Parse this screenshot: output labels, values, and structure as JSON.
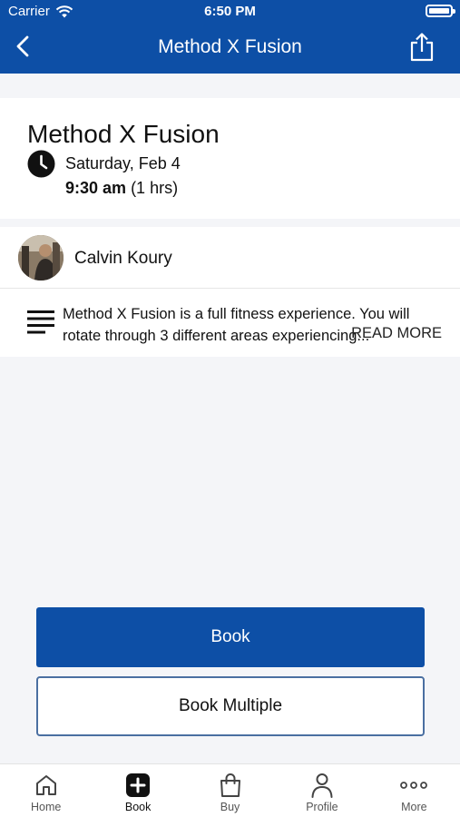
{
  "status_bar": {
    "carrier": "Carrier",
    "time": "6:50 PM"
  },
  "nav": {
    "title": "Method X Fusion"
  },
  "class": {
    "title": "Method X Fusion",
    "date": "Saturday, Feb 4",
    "time": "9:30 am",
    "duration": "(1 hrs)"
  },
  "instructor": {
    "name": "Calvin Koury"
  },
  "description": {
    "text": "Method X Fusion is a full fitness experience. You will rotate through 3 different areas experiencing...",
    "read_more": "READ MORE"
  },
  "actions": {
    "book": "Book",
    "book_multiple": "Book Multiple"
  },
  "tabs": [
    {
      "label": "Home",
      "icon": "home-icon"
    },
    {
      "label": "Book",
      "icon": "plus-square-icon"
    },
    {
      "label": "Buy",
      "icon": "shopping-bag-icon"
    },
    {
      "label": "Profile",
      "icon": "person-icon"
    },
    {
      "label": "More",
      "icon": "more-dots-icon"
    }
  ],
  "colors": {
    "brand": "#0d4fa6",
    "background": "#f4f5f8"
  }
}
